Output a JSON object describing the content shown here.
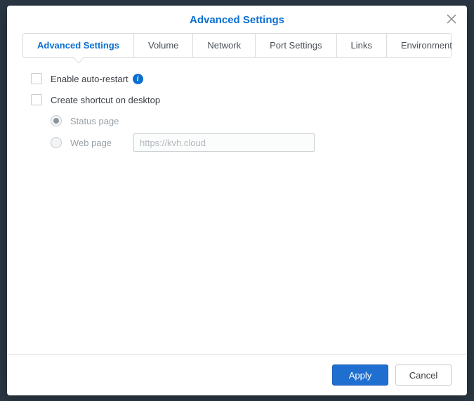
{
  "modal": {
    "title": "Advanced Settings"
  },
  "tabs": [
    {
      "label": "Advanced Settings",
      "active": true
    },
    {
      "label": "Volume",
      "active": false
    },
    {
      "label": "Network",
      "active": false
    },
    {
      "label": "Port Settings",
      "active": false
    },
    {
      "label": "Links",
      "active": false
    },
    {
      "label": "Environment",
      "active": false
    }
  ],
  "options": {
    "enable_auto_restart": "Enable auto-restart",
    "create_shortcut": "Create shortcut on desktop",
    "status_page": "Status page",
    "web_page": "Web page",
    "web_page_placeholder": "https://kvh.cloud"
  },
  "footer": {
    "apply": "Apply",
    "cancel": "Cancel"
  }
}
